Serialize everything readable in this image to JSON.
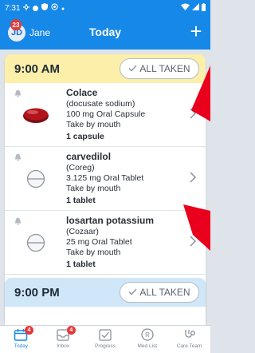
{
  "status_bar": {
    "time": "7:31"
  },
  "header": {
    "avatar_initials": "JD",
    "avatar_badge": "23",
    "user_name": "Jane",
    "title": "Today",
    "add_label": "+"
  },
  "doses": [
    {
      "time": "9:00 AM",
      "all_taken_label": "ALL TAKEN",
      "medications": [
        {
          "name": "Colace",
          "generic": "(docusate sodium)",
          "strength": "100 mg Oral Capsule",
          "route": "Take by mouth",
          "quantity": "1 capsule",
          "pill_icon": "red-capsule-icon"
        },
        {
          "name": "carvedilol",
          "generic": "(Coreg)",
          "strength": "3.125 mg Oral Tablet",
          "route": "Take by mouth",
          "quantity": "1 tablet",
          "pill_icon": "white-tablet-icon"
        },
        {
          "name": "losartan potassium",
          "generic": "(Cozaar)",
          "strength": "25 mg Oral Tablet",
          "route": "Take by mouth",
          "quantity": "1 tablet",
          "pill_icon": "white-tablet-icon"
        }
      ]
    },
    {
      "time": "9:00 PM",
      "all_taken_label": "ALL TAKEN",
      "medications": []
    }
  ],
  "bottom_nav": [
    {
      "label": "Today",
      "badge": "4",
      "icon": "calendar-icon",
      "active": true
    },
    {
      "label": "Inbox",
      "badge": "4",
      "icon": "inbox-icon",
      "active": false
    },
    {
      "label": "Progress",
      "badge": "",
      "icon": "checkbox-icon",
      "active": false
    },
    {
      "label": "Med List",
      "badge": "",
      "icon": "pill-icon",
      "active": false
    },
    {
      "label": "Care Team",
      "badge": "",
      "icon": "stethoscope-icon",
      "active": false
    }
  ],
  "colors": {
    "header_blue": "#1688e7",
    "am_header": "#fbefa9",
    "pm_header": "#cfe7f8",
    "badge_red": "#e23a3a",
    "annotation_red": "#e8001c"
  }
}
